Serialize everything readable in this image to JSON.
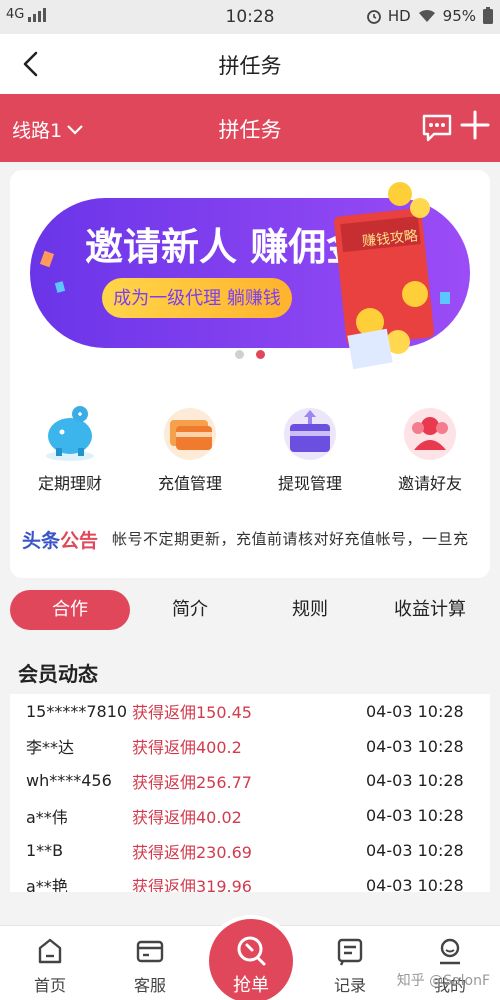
{
  "status_bar": {
    "network": "4G",
    "time": "10:28",
    "hd": "HD",
    "battery": "95%"
  },
  "title_bar": {
    "title": "拼任务"
  },
  "red_bar": {
    "route": "线路1",
    "title": "拼任务"
  },
  "banner": {
    "headline": "邀请新人 赚佣金",
    "subline": "成为一级代理 躺赚钱",
    "book_label": "赚钱攻略",
    "dots": 2,
    "active_dot": 2
  },
  "menu": [
    {
      "label": "定期理财",
      "icon": "piggy-bank-icon"
    },
    {
      "label": "充值管理",
      "icon": "card-icon"
    },
    {
      "label": "提现管理",
      "icon": "withdraw-icon"
    },
    {
      "label": "邀请好友",
      "icon": "friends-icon"
    }
  ],
  "notice": {
    "tag_a": "头条",
    "tag_b": "公告",
    "text": "帐号不定期更新，充值前请核对好充值帐号，一旦充"
  },
  "tabs": [
    {
      "label": "合作",
      "active": true
    },
    {
      "label": "简介",
      "active": false
    },
    {
      "label": "规则",
      "active": false
    },
    {
      "label": "收益计算",
      "active": false
    }
  ],
  "members": {
    "title": "会员动态",
    "rows": [
      {
        "name": "15*****7810",
        "reward": "获得返佣150.45",
        "time": "04-03 10:28"
      },
      {
        "name": "李**达",
        "reward": "获得返佣400.2",
        "time": "04-03 10:28"
      },
      {
        "name": "wh****456",
        "reward": "获得返佣256.77",
        "time": "04-03 10:28"
      },
      {
        "name": "a**伟",
        "reward": "获得返佣40.02",
        "time": "04-03 10:28"
      },
      {
        "name": "1**B",
        "reward": "获得返佣230.69",
        "time": "04-03 10:28"
      },
      {
        "name": "a**艳",
        "reward": "获得返佣319.96",
        "time": "04-03 10:28"
      }
    ]
  },
  "tab_bar": {
    "home": "首页",
    "service": "客服",
    "grab": "抢单",
    "records": "记录",
    "mine": "我的"
  },
  "watermark": "知乎 @SalonF",
  "colors": {
    "accent": "#e0475a",
    "notice_blue": "#3b55c9",
    "banner_purple": "#7b3ff2"
  }
}
